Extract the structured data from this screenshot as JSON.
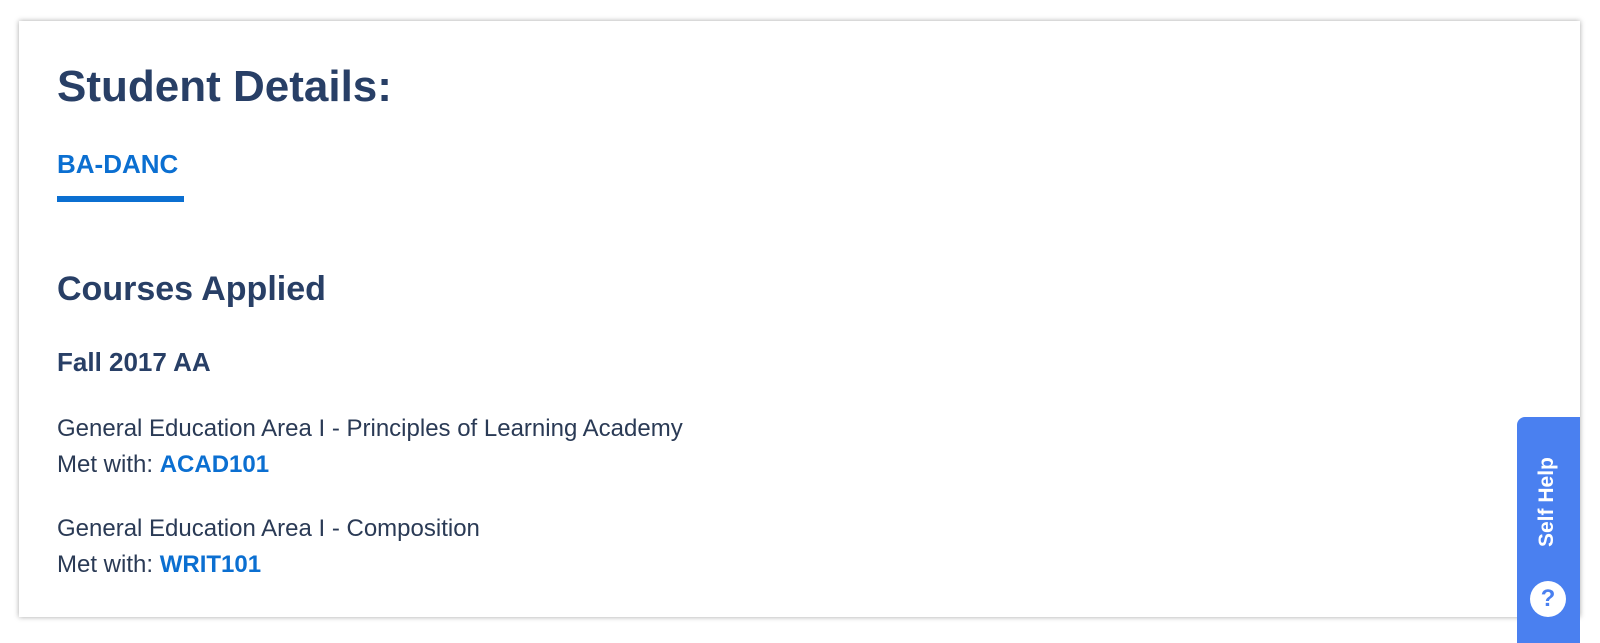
{
  "header": {
    "title": "Student Details:"
  },
  "tabs": [
    {
      "label": "BA-DANC",
      "active": true
    }
  ],
  "courses": {
    "title": "Courses Applied",
    "term": "Fall 2017 AA",
    "requirements": [
      {
        "name": "General Education Area I - Principles of Learning Academy",
        "met_prefix": "Met with:",
        "course": "ACAD101"
      },
      {
        "name": "General Education Area I - Composition",
        "met_prefix": "Met with:",
        "course": "WRIT101"
      }
    ]
  },
  "self_help": {
    "label": "Self Help",
    "icon": "question-icon",
    "icon_glyph": "?"
  },
  "colors": {
    "heading": "#283f66",
    "accent": "#0b6fd1",
    "help_button": "#4a80f0"
  }
}
